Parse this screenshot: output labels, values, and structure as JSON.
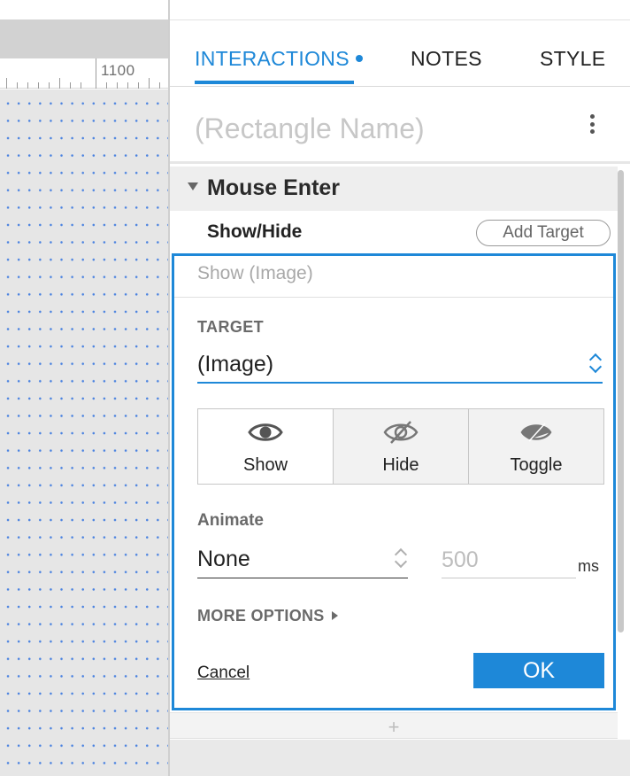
{
  "canvas": {
    "ruler_label": "1100"
  },
  "tabs": [
    {
      "label": "INTERACTIONS",
      "active": true,
      "has_indicator": true
    },
    {
      "label": "NOTES",
      "active": false
    },
    {
      "label": "STYLE",
      "active": false
    }
  ],
  "widget": {
    "name_placeholder": "(Rectangle Name)"
  },
  "event": {
    "title": "Mouse Enter",
    "expanded": true
  },
  "action": {
    "title": "Show/Hide",
    "add_target_label": "Add Target",
    "summary": "Show (Image)"
  },
  "editor": {
    "target_label": "TARGET",
    "target_value": "(Image)",
    "visibility_options": [
      {
        "label": "Show",
        "icon": "eye-icon",
        "selected": true
      },
      {
        "label": "Hide",
        "icon": "eye-slash-icon",
        "selected": false
      },
      {
        "label": "Toggle",
        "icon": "eye-half-icon",
        "selected": false
      }
    ],
    "animate_label": "Animate",
    "animate_value": "None",
    "duration_placeholder": "500",
    "duration_unit": "ms",
    "more_options_label": "MORE OPTIONS",
    "cancel_label": "Cancel",
    "ok_label": "OK"
  },
  "add_interaction_label": "+",
  "colors": {
    "accent": "#1e88d8",
    "canvas_grid_dot": "#4a82e0",
    "canvas_background": "#e6e6e6"
  }
}
